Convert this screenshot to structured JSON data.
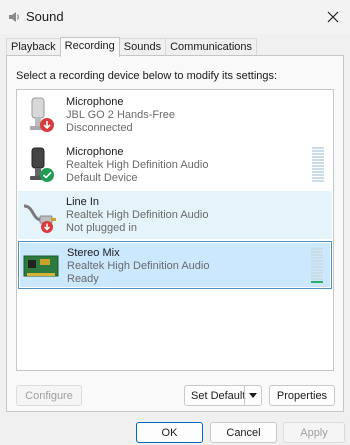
{
  "window": {
    "title": "Sound",
    "icon": "speaker-icon"
  },
  "tabs": [
    {
      "label": "Playback",
      "active": false
    },
    {
      "label": "Recording",
      "active": true
    },
    {
      "label": "Sounds",
      "active": false
    },
    {
      "label": "Communications",
      "active": false
    }
  ],
  "instructions": "Select a recording device below to modify its settings:",
  "devices": [
    {
      "name": "Microphone",
      "description": "JBL GO 2 Hands-Free",
      "status": "Disconnected",
      "icon": "microphone-icon",
      "badge": "red-down-arrow",
      "state": "normal",
      "meter_level": null
    },
    {
      "name": "Microphone",
      "description": "Realtek High Definition Audio",
      "status": "Default Device",
      "icon": "microphone-icon",
      "badge": "green-check",
      "state": "normal",
      "meter_level": 0
    },
    {
      "name": "Line In",
      "description": "Realtek High Definition Audio",
      "status": "Not plugged in",
      "icon": "line-in-cable-icon",
      "badge": "red-down-arrow",
      "state": "hover",
      "meter_level": null
    },
    {
      "name": "Stereo Mix",
      "description": "Realtek High Definition Audio",
      "status": "Ready",
      "icon": "sound-card-icon",
      "badge": null,
      "state": "selected",
      "meter_level": 0.05
    }
  ],
  "buttons": {
    "configure": "Configure",
    "set_default": "Set Default",
    "properties": "Properties",
    "ok": "OK",
    "cancel": "Cancel",
    "apply": "Apply"
  },
  "colors": {
    "accent": "#0067c0",
    "selection": "#cce8ff",
    "meter_active": "#2bae66"
  }
}
